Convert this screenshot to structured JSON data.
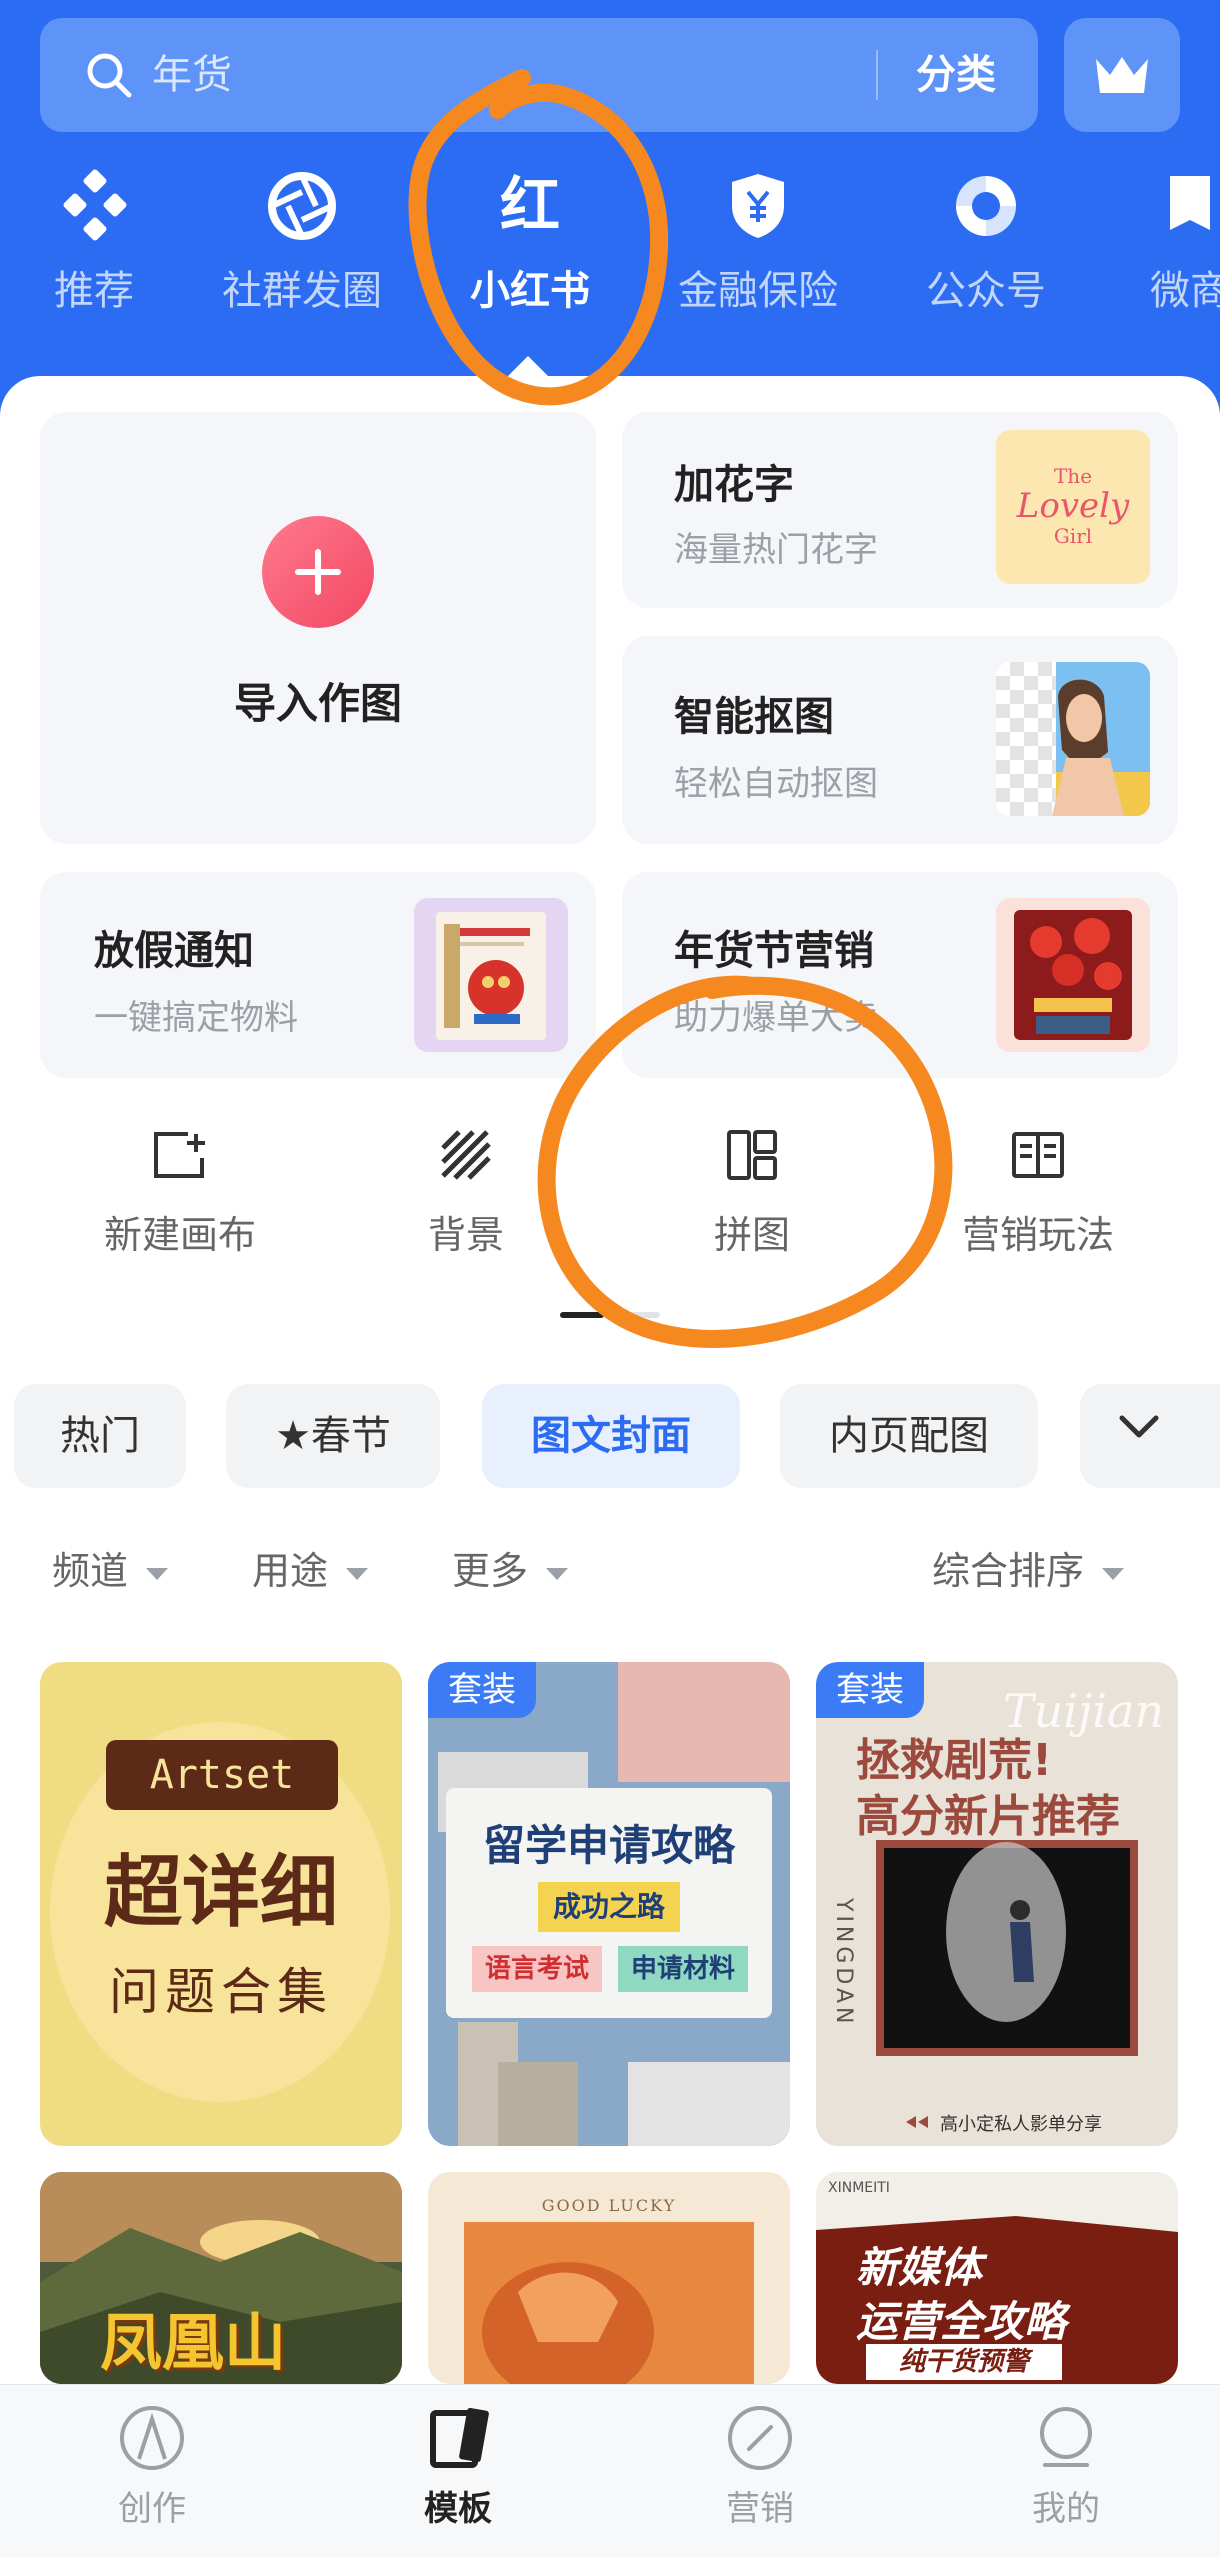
{
  "search": {
    "placeholder": "年货",
    "category_label": "分类"
  },
  "top_tabs": [
    {
      "label": "推荐",
      "icon": "diamond-cluster-icon"
    },
    {
      "label": "社群发圈",
      "icon": "aperture-icon"
    },
    {
      "label": "小红书",
      "icon_text": "红",
      "active": true
    },
    {
      "label": "金融保险",
      "icon": "yuan-shield-icon"
    },
    {
      "label": "公众号",
      "icon": "swirl-icon"
    },
    {
      "label": "微商",
      "icon": "bag-icon"
    }
  ],
  "tools": {
    "import": {
      "label": "导入作图"
    },
    "fancy_text": {
      "title": "加花字",
      "sub": "海量热门花字",
      "thumb_text": [
        "The",
        "Lovely",
        "Girl"
      ]
    },
    "smart_cutout": {
      "title": "智能抠图",
      "sub": "轻松自动抠图"
    },
    "holiday_notice": {
      "title": "放假通知",
      "sub": "一键搞定物料"
    },
    "new_year_marketing": {
      "title": "年货节营销",
      "sub": "助力爆单大卖"
    }
  },
  "quick_actions": [
    {
      "label": "新建画布",
      "icon": "new-canvas-icon"
    },
    {
      "label": "背景",
      "icon": "stripes-icon"
    },
    {
      "label": "拼图",
      "icon": "collage-icon"
    },
    {
      "label": "营销玩法",
      "icon": "book-icon"
    }
  ],
  "categories": [
    {
      "label": "热门"
    },
    {
      "label": "★春节"
    },
    {
      "label": "图文封面",
      "active": true
    },
    {
      "label": "内页配图"
    }
  ],
  "filters": [
    {
      "label": "频道"
    },
    {
      "label": "用途"
    },
    {
      "label": "更多"
    },
    {
      "label": "综合排序"
    }
  ],
  "templates": [
    {
      "badge": "",
      "tag": "Artset",
      "title": "超详细",
      "sub": "问题合集"
    },
    {
      "badge": "套装",
      "title": "留学申请攻略",
      "sub": "成功之路",
      "pills": [
        "语言考试",
        "申请材料"
      ]
    },
    {
      "badge": "套装",
      "title_lines": [
        "拯救剧荒!",
        "高分新片推荐"
      ],
      "script": "Tuijian",
      "vertical": "YINGDAN",
      "caption": "高小定私人影单分享"
    },
    {
      "badge": "",
      "title": "凤凰山"
    },
    {
      "badge": "",
      "header": "GOOD LUCKY"
    },
    {
      "badge": "",
      "brand": "XINMEITI",
      "title_lines": [
        "新媒体",
        "运营全攻略"
      ],
      "tag": "纯干货预警"
    }
  ],
  "bottom_nav": [
    {
      "label": "创作",
      "icon": "create-icon"
    },
    {
      "label": "模板",
      "icon": "template-icon",
      "active": true
    },
    {
      "label": "营销",
      "icon": "marketing-icon"
    },
    {
      "label": "我的",
      "icon": "profile-icon"
    }
  ],
  "colors": {
    "brand_blue": "#2B6CF3",
    "accent_red": "#F24863",
    "annotation_orange": "#F5891F"
  }
}
